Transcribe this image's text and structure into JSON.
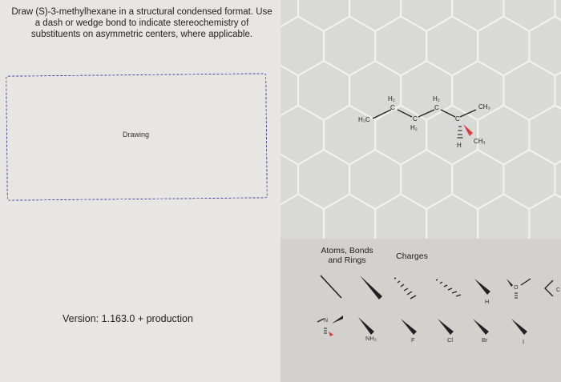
{
  "question": {
    "text": "Draw (S)-3-methylhexane in a structural condensed format. Use a dash or wedge bond to indicate stereochemistry of substituents on asymmetric centers, where applicable."
  },
  "drawing": {
    "label": "Drawing"
  },
  "version": {
    "text": "Version: 1.163.0 + production"
  },
  "molecule": {
    "labels": {
      "h3c": "H₃C",
      "ch2_a_h": "H₂",
      "ch2_a_c": "C",
      "ch2_b_c": "C",
      "ch2_b_h": "H₂",
      "ch2_c_h": "H₂",
      "ch2_c_c": "C",
      "stereo_c": "C",
      "stereo_h": "H",
      "ch3_top": "CH₃",
      "ch3_right": "CH₃"
    }
  },
  "toolbar": {
    "tabs": {
      "atoms": "Atoms, Bonds and Rings",
      "charges": "Charges"
    },
    "row1": [
      {
        "name": "single-bond",
        "label": ""
      },
      {
        "name": "wedge-bond",
        "label": ""
      },
      {
        "name": "dash-bond",
        "label": ""
      },
      {
        "name": "hash-bond",
        "label": ""
      },
      {
        "name": "wedge-h",
        "label": "H"
      },
      {
        "name": "wedge-o",
        "label": "O"
      },
      {
        "name": "wedge-c",
        "label": "C"
      }
    ],
    "row2": [
      {
        "name": "wedge-n",
        "label": "N"
      },
      {
        "name": "wedge-nh2",
        "label": "NH₂"
      },
      {
        "name": "wedge-f",
        "label": "F"
      },
      {
        "name": "wedge-cl",
        "label": "Cl"
      },
      {
        "name": "wedge-br",
        "label": "Br"
      },
      {
        "name": "wedge-i",
        "label": "I"
      }
    ]
  },
  "colors": {
    "hex_line": "#f2f2f0",
    "bond": "#222222",
    "stereo_wedge": "#e23a3a",
    "dashed_border": "#3b3fa8"
  }
}
